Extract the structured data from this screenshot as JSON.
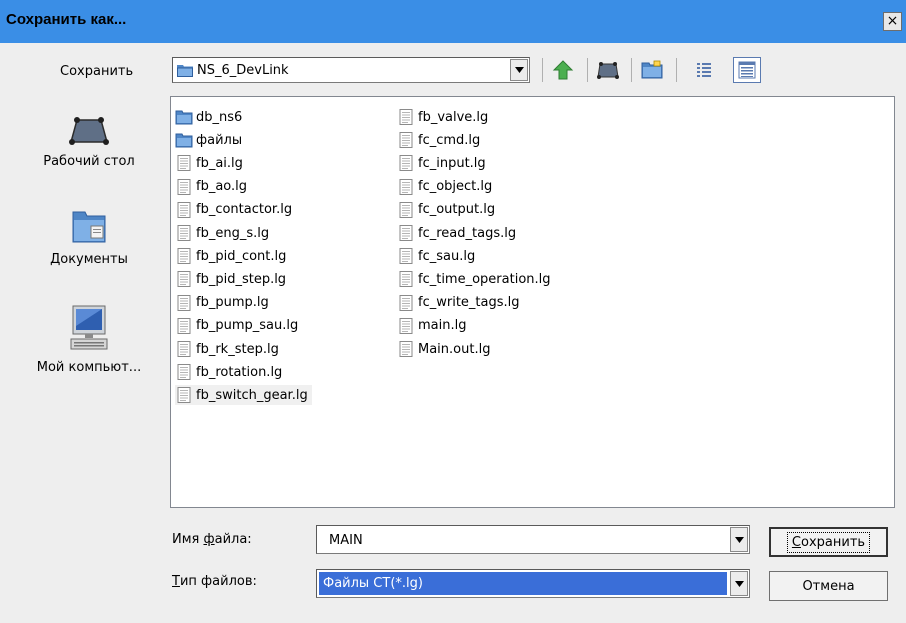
{
  "window": {
    "title": "Сохранить как...",
    "close_glyph": "×"
  },
  "location": {
    "label": "Сохранить",
    "current_folder": "NS_6_DevLink"
  },
  "toolbar": {
    "icons": [
      "up-folder-icon",
      "network-icon",
      "new-folder-icon",
      "list-view-icon",
      "details-view-icon"
    ]
  },
  "sidebar": {
    "items": [
      {
        "label": "Рабочий стол",
        "icon": "desktop-icon"
      },
      {
        "label": "Документы",
        "icon": "documents-icon"
      },
      {
        "label": "Мой компьют...",
        "icon": "computer-icon"
      }
    ]
  },
  "files": {
    "column1": [
      {
        "name": "db_ns6",
        "type": "folder"
      },
      {
        "name": "файлы",
        "type": "folder"
      },
      {
        "name": "fb_ai.lg",
        "type": "file"
      },
      {
        "name": "fb_ao.lg",
        "type": "file"
      },
      {
        "name": "fb_contactor.lg",
        "type": "file"
      },
      {
        "name": "fb_eng_s.lg",
        "type": "file"
      },
      {
        "name": "fb_pid_cont.lg",
        "type": "file"
      },
      {
        "name": "fb_pid_step.lg",
        "type": "file"
      },
      {
        "name": "fb_pump.lg",
        "type": "file"
      },
      {
        "name": "fb_pump_sau.lg",
        "type": "file"
      },
      {
        "name": "fb_rk_step.lg",
        "type": "file"
      },
      {
        "name": "fb_rotation.lg",
        "type": "file"
      },
      {
        "name": "fb_switch_gear.lg",
        "type": "file"
      }
    ],
    "column2": [
      {
        "name": "fb_valve.lg",
        "type": "file"
      },
      {
        "name": "fc_cmd.lg",
        "type": "file"
      },
      {
        "name": "fc_input.lg",
        "type": "file"
      },
      {
        "name": "fc_object.lg",
        "type": "file"
      },
      {
        "name": "fc_output.lg",
        "type": "file"
      },
      {
        "name": "fc_read_tags.lg",
        "type": "file"
      },
      {
        "name": "fc_sau.lg",
        "type": "file"
      },
      {
        "name": "fc_time_operation.lg",
        "type": "file"
      },
      {
        "name": "fc_write_tags.lg",
        "type": "file"
      },
      {
        "name": "main.lg",
        "type": "file"
      },
      {
        "name": "Main.out.lg",
        "type": "file"
      }
    ]
  },
  "filename": {
    "label_pre": "Имя ",
    "label_ul": "ф",
    "label_post": "айла:",
    "value": "MAIN"
  },
  "filetype": {
    "label_ul": "Т",
    "label_post": "ип файлов:",
    "value": "Файлы СТ(*.lg)"
  },
  "buttons": {
    "save_ul": "С",
    "save_rest": "охранить",
    "cancel": "Отмена"
  },
  "colors": {
    "titlebar": "#3a8ee6",
    "selection": "#3a6ed8",
    "folder": "#4f86c6"
  }
}
